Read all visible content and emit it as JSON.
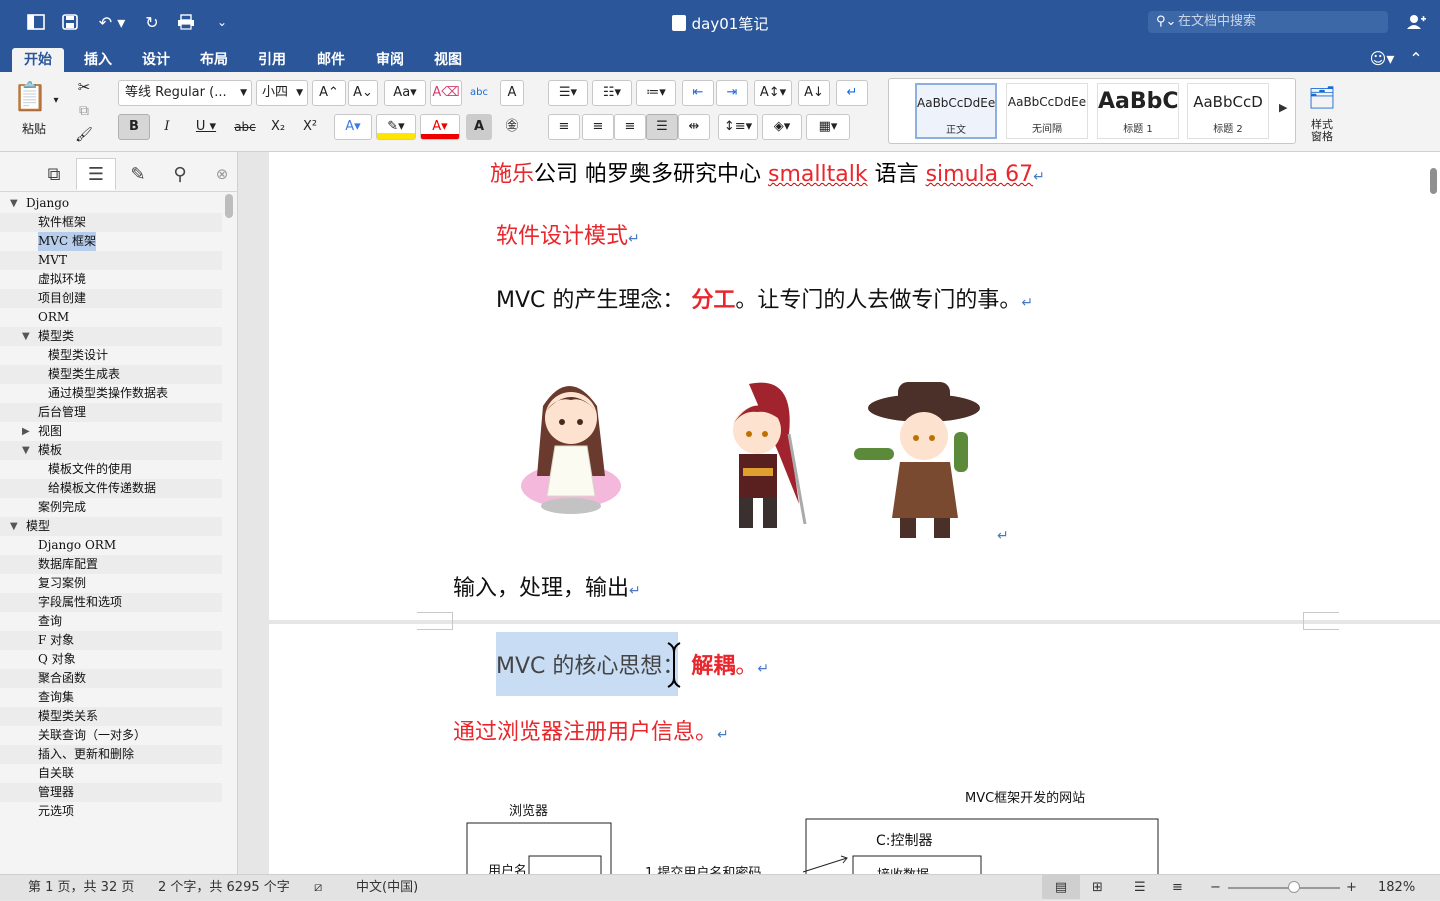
{
  "window": {
    "title": "day01笔记",
    "search_placeholder": "在文档中搜索"
  },
  "tabs": [
    {
      "label": "开始",
      "active": true
    },
    {
      "label": "插入"
    },
    {
      "label": "设计"
    },
    {
      "label": "布局"
    },
    {
      "label": "引用"
    },
    {
      "label": "邮件"
    },
    {
      "label": "审阅"
    },
    {
      "label": "视图"
    }
  ],
  "ribbon": {
    "paste_label": "粘贴",
    "font_name": "等线 Regular (...",
    "font_size": "小四",
    "styles": [
      {
        "sample": "AaBbCcDdEe",
        "name": "正文",
        "selected": true
      },
      {
        "sample": "AaBbCcDdEe",
        "name": "无间隔"
      },
      {
        "sample": "AaBbC",
        "name": "标题 1"
      },
      {
        "sample": "AaBbCcD",
        "name": "标题 2"
      }
    ],
    "styles_pane_label": "样式\n窗格"
  },
  "toc": [
    {
      "label": "Django",
      "level": 0,
      "arrow": "down"
    },
    {
      "label": "软件框架",
      "level": 1
    },
    {
      "label": "MVC 框架",
      "level": 1,
      "highlight": true
    },
    {
      "label": "MVT",
      "level": 1
    },
    {
      "label": "虚拟环境",
      "level": 1
    },
    {
      "label": "项目创建",
      "level": 1
    },
    {
      "label": "ORM",
      "level": 1
    },
    {
      "label": "模型类",
      "level": 1,
      "arrow": "down"
    },
    {
      "label": "模型类设计",
      "level": 2
    },
    {
      "label": "模型类生成表",
      "level": 2
    },
    {
      "label": "通过模型类操作数据表",
      "level": 2
    },
    {
      "label": "后台管理",
      "level": 1
    },
    {
      "label": "视图",
      "level": 1,
      "arrow": "right"
    },
    {
      "label": "模板",
      "level": 1,
      "arrow": "down"
    },
    {
      "label": "模板文件的使用",
      "level": 2
    },
    {
      "label": "给模板文件传递数据",
      "level": 2
    },
    {
      "label": "案例完成",
      "level": 1
    },
    {
      "label": "模型",
      "level": 0,
      "arrow": "down"
    },
    {
      "label": "Django ORM",
      "level": 1
    },
    {
      "label": "数据库配置",
      "level": 1
    },
    {
      "label": "复习案例",
      "level": 1
    },
    {
      "label": "字段属性和选项",
      "level": 1
    },
    {
      "label": "查询",
      "level": 1
    },
    {
      "label": "F 对象",
      "level": 1
    },
    {
      "label": "Q 对象",
      "level": 1
    },
    {
      "label": "聚合函数",
      "level": 1
    },
    {
      "label": "查询集",
      "level": 1
    },
    {
      "label": "模型类关系",
      "level": 1
    },
    {
      "label": "关联查询（一对多）",
      "level": 1
    },
    {
      "label": "插入、更新和删除",
      "level": 1
    },
    {
      "label": "自关联",
      "level": 1
    },
    {
      "label": "管理器",
      "level": 1
    },
    {
      "label": "元选项",
      "level": 1
    }
  ],
  "doc": {
    "line1": {
      "p1": "施乐",
      "p2": "公司  帕罗奥多研究中心  ",
      "p3": "smalltalk",
      "p4": " 语言  ",
      "p5": "simula 67"
    },
    "line2": "软件设计模式",
    "line3": {
      "p1": "MVC 的产生理念：  ",
      "p2": "分工",
      "p3": "。让专门的人去做专门的事。"
    },
    "line4": "输入，处理，输出",
    "line5": {
      "p1": "MVC 的核心思想：  ",
      "p2": "解耦",
      "p3": "。"
    },
    "line6": "通过浏览器注册用户信息。",
    "diagram": {
      "browser_label": "浏览器",
      "site_label": "MVC框架开发的网站",
      "controller_label": "C:控制器",
      "username_label": "用户名",
      "submit_label": "1.提交用户名和密码",
      "receive_label": "接收数据"
    },
    "paragraph_mark": "↵"
  },
  "status": {
    "page": "第 1 页，共 32 页",
    "words": "2 个字，共 6295 个字",
    "language": "中文(中国)",
    "zoom": "182%"
  }
}
